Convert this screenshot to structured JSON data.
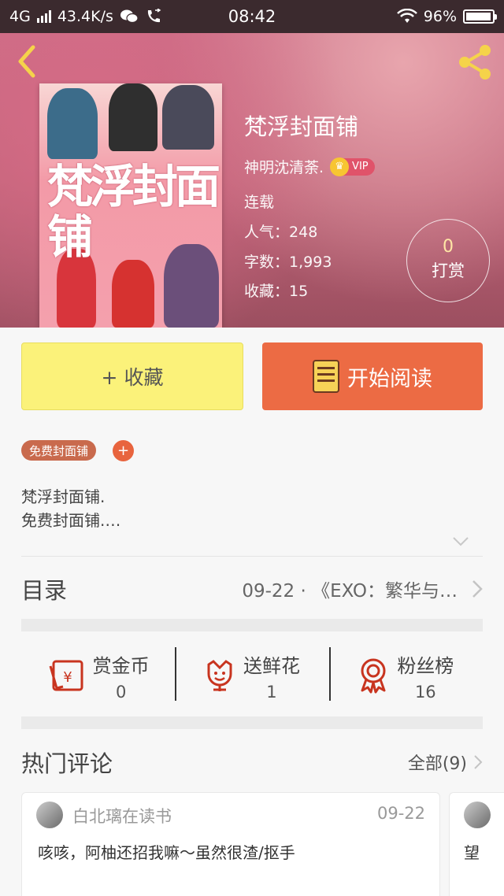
{
  "status_bar": {
    "network": "4G",
    "speed": "43.4K/s",
    "time": "08:42",
    "battery": "96%",
    "battery_level": 0.96
  },
  "book": {
    "title": "梵浮封面铺",
    "author": "神明沈清荼.",
    "vip": "VIP",
    "status": "连载",
    "popularity_label": "人气：",
    "popularity": "248",
    "words_label": "字数：",
    "words": "1,993",
    "favorites_label": "收藏：",
    "favorites": "15",
    "cover_title": "梵浮封面铺"
  },
  "tip": {
    "count": "0",
    "label": "打赏"
  },
  "actions": {
    "collect": "+ 收藏",
    "read": "开始阅读"
  },
  "tags": [
    "免费封面铺"
  ],
  "tag_add": "+",
  "description": [
    "梵浮封面铺.",
    "免费封面铺.…"
  ],
  "toc": {
    "title": "目录",
    "latest": "09-22 · 《EXO：繁华与…"
  },
  "stats": [
    {
      "label": "赏金币",
      "value": "0",
      "icon": "coin-envelope-icon"
    },
    {
      "label": "送鲜花",
      "value": "1",
      "icon": "flower-icon"
    },
    {
      "label": "粉丝榜",
      "value": "16",
      "icon": "rosette-icon"
    }
  ],
  "comments_section": {
    "title": "热门评论",
    "all": "全部(9)"
  },
  "comments": [
    {
      "user": "白北璃在读书",
      "date": "09-22",
      "text": "咳咳，阿柚还招我嘛～虽然很渣/抠手"
    },
    {
      "user": "",
      "date": "",
      "text": "望"
    }
  ],
  "colors": {
    "accent_orange": "#ec6b44",
    "collect_yellow": "#fbf27a",
    "icon_red": "#c8341f",
    "header_pink": "#c96d86"
  }
}
